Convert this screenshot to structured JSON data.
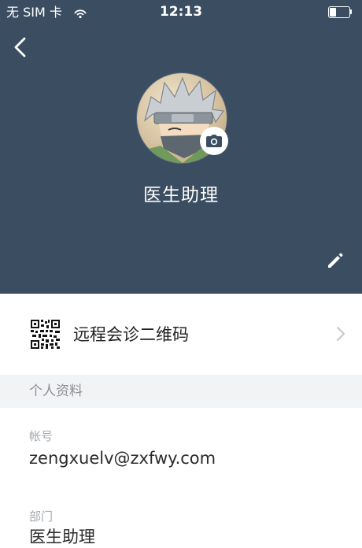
{
  "status_bar": {
    "carrier": "无 SIM 卡",
    "time": "12:13",
    "wifi_icon": "wifi-icon",
    "battery_icon": "battery-icon",
    "battery_level": 0.35
  },
  "nav": {
    "back_icon": "chevron-left-icon"
  },
  "profile": {
    "name": "医生助理",
    "avatar": "avatar-image",
    "camera_icon": "camera-icon",
    "edit_icon": "pencil-icon"
  },
  "qr": {
    "label": "远程会诊二维码",
    "icon": "qr-code-icon",
    "chevron_icon": "chevron-right-icon"
  },
  "section": {
    "title": "个人资料"
  },
  "fields": {
    "account_label": "帐号",
    "account_value": "zengxuelv@zxfwy.com",
    "department_label": "部门",
    "department_value": "医生助理"
  },
  "colors": {
    "header_bg": "#3b4d61",
    "section_bg": "#f2f3f4",
    "text_primary": "#2b2b2b",
    "text_secondary": "#a4a8ad"
  }
}
